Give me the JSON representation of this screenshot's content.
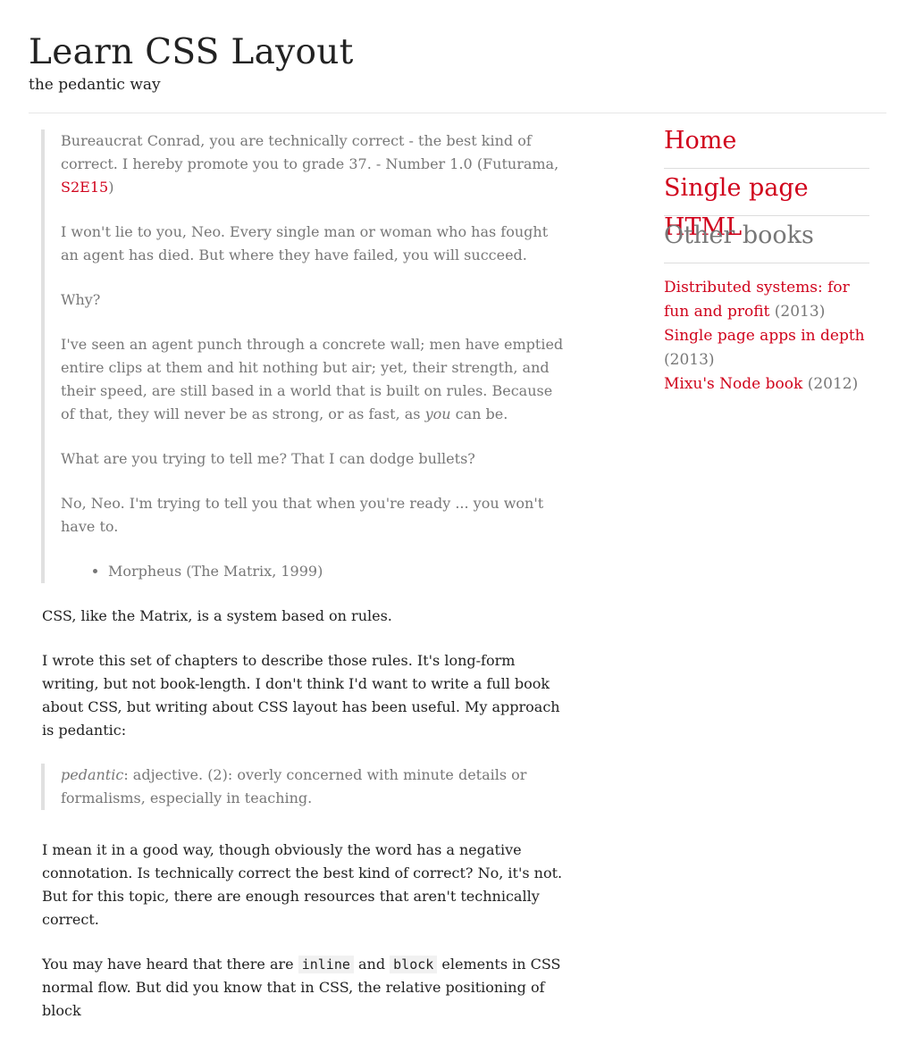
{
  "header": {
    "title": "Learn CSS Layout",
    "subtitle": "the pedantic way"
  },
  "quote1": {
    "p1_text": "Bureaucrat Conrad, you are technically correct - the best kind of correct. I hereby promote you to grade 37. - Number 1.0 (Futurama, ",
    "p1_link": "S2E15",
    "p1_end": ")",
    "p2": "I won't lie to you, Neo. Every single man or woman who has fought an agent has died. But where they have failed, you will succeed.",
    "p3": "Why?",
    "p4_text": "I've seen an agent punch through a concrete wall; men have emptied entire clips at them and hit nothing but air; yet, their strength, and their speed, are still based in a world that is built on rules. Because of that, they will never be as strong, or as fast, as ",
    "p4_em": "you",
    "p4_end": " can be.",
    "p5": "What are you trying to tell me? That I can dodge bullets?",
    "p6": "No, Neo. I'm trying to tell you that when you're ready ... you won't have to.",
    "attribution": "Morpheus (The Matrix, 1999)"
  },
  "body": {
    "p1": "CSS, like the Matrix, is a system based on rules.",
    "p2": "I wrote this set of chapters to describe those rules. It's long-form writing, but not book-length. I don't think I'd want to write a full book about CSS, but writing about CSS layout has been useful. My approach is pedantic:",
    "def_term": "pedantic",
    "def_text": ": adjective. (2): overly concerned with minute details or formalisms, especially in teaching.",
    "p3": "I mean it in a good way, though obviously the word has a negative connotation. Is technically correct the best kind of correct? No, it's not. But for this topic, there are enough resources that aren't technically correct.",
    "p4_a": "You may have heard that there are ",
    "p4_code1": "inline",
    "p4_b": " and ",
    "p4_code2": "block",
    "p4_c": " elements in CSS normal flow. But did you know that in CSS, the relative positioning of block"
  },
  "sidebar": {
    "nav": [
      {
        "label": "Home"
      },
      {
        "label": "Single page HTML"
      }
    ],
    "other_heading": "Other books",
    "books": [
      {
        "title": "Distributed systems: for fun and profit",
        "year": "(2013)"
      },
      {
        "title": "Single page apps in depth",
        "year": "(2013)"
      },
      {
        "title": "Mixu's Node book",
        "year": "(2012)"
      }
    ]
  },
  "colors": {
    "link": "#d0021b",
    "muted": "#777777",
    "text": "#222222"
  }
}
